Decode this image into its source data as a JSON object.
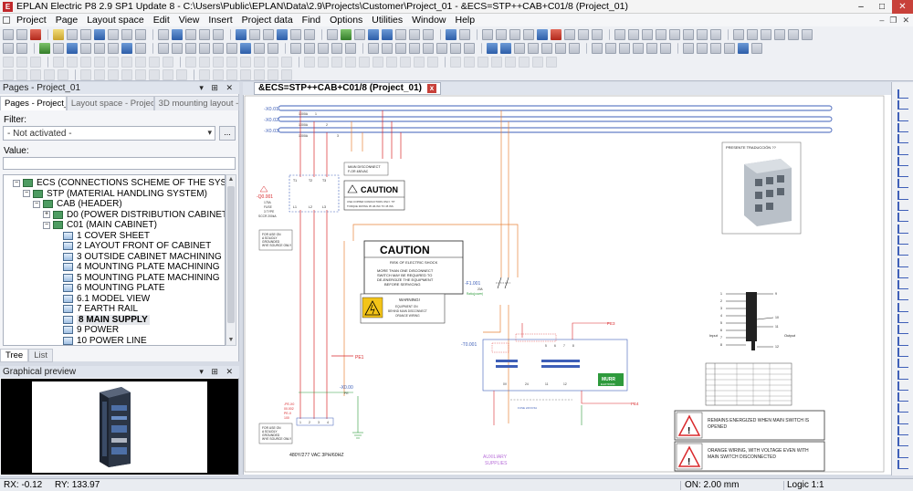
{
  "app": {
    "title": "EPLAN Electric P8 2.9 SP1 Update 8 - C:\\Users\\Public\\EPLAN\\Data\\2.9\\Projects\\Customer\\Project_01 - &ECS=STP++CAB+C01/8 (Project_01)",
    "window_controls": [
      "–",
      "□",
      "✕"
    ]
  },
  "menu": [
    "Project",
    "Page",
    "Layout space",
    "Edit",
    "View",
    "Insert",
    "Project data",
    "Find",
    "Options",
    "Utilities",
    "Window",
    "Help"
  ],
  "pages_pane": {
    "header": "Pages - Project_01",
    "header_controls": "▾ ⊞ ✕",
    "tabs": [
      "Pages - Project_01",
      "Layout space - Project_01",
      "3D mounting layout - Pr..."
    ],
    "filter_label": "Filter:",
    "filter_value": "- Not activated -",
    "filter_button": "...",
    "value_label": "Value:",
    "tree": [
      {
        "label": "ECS (CONNECTIONS SCHEME OF THE SYSTEM)",
        "level": 0,
        "type": "struct",
        "exp": "−"
      },
      {
        "label": "STP (MATERIAL HANDLING SYSTEM)",
        "level": 1,
        "type": "struct",
        "exp": "−"
      },
      {
        "label": "CAB (HEADER)",
        "level": 2,
        "type": "struct",
        "exp": "−"
      },
      {
        "label": "D0 (POWER DISTRIBUTION CABINET)",
        "level": 3,
        "type": "struct",
        "exp": "+"
      },
      {
        "label": "C01 (MAIN CABINET)",
        "level": 3,
        "type": "struct",
        "exp": "−"
      },
      {
        "label": "1 COVER SHEET",
        "level": 4,
        "type": "page"
      },
      {
        "label": "2 LAYOUT FRONT OF CABINET",
        "level": 4,
        "type": "page"
      },
      {
        "label": "3 OUTSIDE CABINET MACHINING",
        "level": 4,
        "type": "page"
      },
      {
        "label": "4 MOUNTING PLATE MACHINING",
        "level": 4,
        "type": "page"
      },
      {
        "label": "5 MOUNTING PLATE MACHINING",
        "level": 4,
        "type": "page"
      },
      {
        "label": "6 MOUNTING PLATE",
        "level": 4,
        "type": "page"
      },
      {
        "label": "6.1 MODEL VIEW",
        "level": 4,
        "type": "page"
      },
      {
        "label": "7 EARTH RAIL",
        "level": 4,
        "type": "page"
      },
      {
        "label": "8 MAIN SUPPLY",
        "level": 4,
        "type": "page",
        "selected": true
      },
      {
        "label": "9 POWER",
        "level": 4,
        "type": "page"
      },
      {
        "label": "10 POWER LINE",
        "level": 4,
        "type": "page"
      }
    ],
    "bottom_tabs": [
      "Tree",
      "List"
    ]
  },
  "preview_pane": {
    "header": "Graphical preview",
    "header_controls": "▾ ⊞ ✕"
  },
  "document": {
    "tab_label": "&ECS=STP++CAB+C01/8 (Project_01)",
    "tab_close": "x",
    "dropdown": "▾"
  },
  "schematic": {
    "busbars": [
      "-X0.01",
      "-X0.02",
      "-X0.03"
    ],
    "busbar_notes": [
      "1000A",
      "1000A",
      "1000A"
    ],
    "busbar_pins": [
      "1",
      "2",
      "3"
    ],
    "q_label": "-Q0.001",
    "q_specs": [
      "175A",
      "FUSE",
      "3 TYPE",
      "SCCR 200kA"
    ],
    "q_terminals_top": [
      "T1",
      "T2",
      "T3"
    ],
    "q_terminals_bottom": [
      "L1",
      "L2",
      "L3"
    ],
    "main_disconnect": [
      "MAIN DISCONNECT",
      "F-OR 480VAC"
    ],
    "caution_small_title": "CAUTION",
    "caution_small_text": [
      "USE COPPER CONDUCTORS ONLY. TIT",
      "TORQUE RATING 35 LB-INC TO 45 INS"
    ],
    "caution_big_title": "CAUTION",
    "caution_big_sub": "RISK OF ELECTRIC SHOCK",
    "caution_big_text": [
      "MORE THAN ONE DISCONNECT",
      "SWITCH MAY BE REQUIRED TO",
      "DE-ENERGIZE THE EQUIPMENT",
      "BEFORE SERVICING"
    ],
    "warning_title": "WARNING!",
    "warning_text": [
      "EQUIPMENT ON",
      "BEHIND MAIN DISCONNECT",
      "ORANGE WIRING"
    ],
    "grounded_note": [
      "FOR USE ON",
      "A SOLIDLY",
      "GROUNDED",
      "WYE SOURCE ONLY"
    ],
    "pe1": "PE1",
    "x0_label": "-X0.00",
    "x0_sub": "PE",
    "pe2_labels": [
      "-PE-X0",
      "00.002",
      "PE-X",
      "100"
    ],
    "voltage_note": "480Y/277 VAC 3PH/60HZ",
    "f_label": "-F1.001",
    "f_specs": [
      "20A",
      "Ratio(power)"
    ],
    "t_label": "-T0.001",
    "murr_brand": "MURR",
    "murr_sub": "ELEKTRONIK",
    "pe3": "PE3",
    "pe4": "PE4",
    "aux_label": [
      "AUXILIARY",
      "SUPPLIES"
    ],
    "photo_caption": "PRESENTE TRADUCCIÓN ??",
    "transformer_input": "Input",
    "transformer_output": "Output",
    "transformer_pins_left": [
      "1",
      "2",
      "3",
      "4",
      "5",
      "6",
      "7",
      "8"
    ],
    "transformer_pins_right": [
      "9",
      "10",
      "11",
      "12"
    ],
    "warning1_text": [
      "REMAINS ENERGIZED WHEN MAIN SWITCH IS",
      "OPENED"
    ],
    "warning2_text": [
      "ORANGE WIRING, WITH VOLTAGE EVEN WITH",
      "MAIN SWITCH DISCONNECTED"
    ],
    "terminal_numbers": [
      "1",
      "2",
      "3",
      "4",
      "5",
      "6",
      "7",
      "8"
    ],
    "lower_pins": [
      "0V",
      "24",
      "11",
      "12"
    ],
    "fuse_note": "FUSE 24V/0.5A"
  },
  "status": {
    "rx": "RX: -0.12",
    "ry": "RY: 133.97",
    "on": "ON: 2.00 mm",
    "logic": "Logic 1:1"
  },
  "colors": {
    "schematic_red": "#d9292c",
    "orange_wire": "#e8833a",
    "blue_bus": "#3e5fb8",
    "purple": "#b86fd9",
    "murr_green": "#2e9a3c"
  }
}
